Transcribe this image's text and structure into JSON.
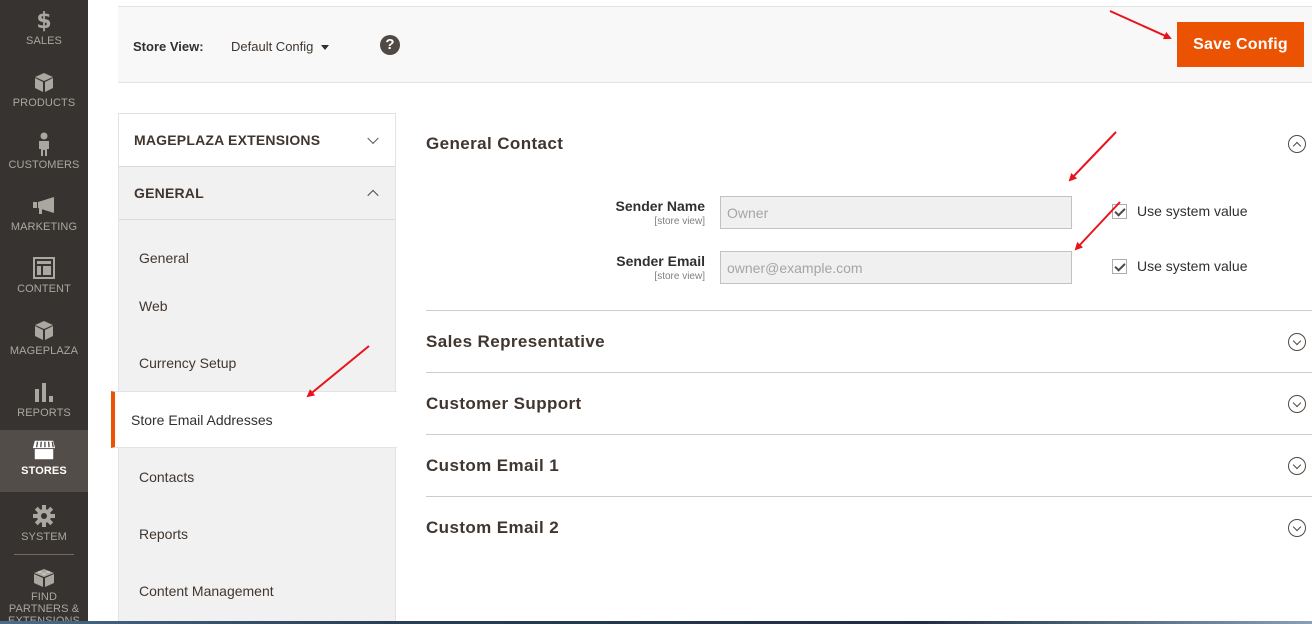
{
  "admin_nav": {
    "items": [
      {
        "label": "SALES",
        "icon": "dollar-icon"
      },
      {
        "label": "PRODUCTS",
        "icon": "box-icon"
      },
      {
        "label": "CUSTOMERS",
        "icon": "person-icon"
      },
      {
        "label": "MARKETING",
        "icon": "megaphone-icon"
      },
      {
        "label": "CONTENT",
        "icon": "layout-icon"
      },
      {
        "label": "MAGEPLAZA",
        "icon": "box-icon"
      },
      {
        "label": "REPORTS",
        "icon": "bar-chart-icon"
      },
      {
        "label": "STORES",
        "icon": "storefront-icon",
        "active": true
      },
      {
        "label": "SYSTEM",
        "icon": "gear-icon"
      },
      {
        "label": "FIND PARTNERS & EXTENSIONS",
        "icon": "lego-brick-icon"
      }
    ]
  },
  "page_actions": {
    "store_view_label": "Store View:",
    "store_view_value": "Default Config",
    "help_label": "?",
    "save_label": "Save Config"
  },
  "config_tabs": {
    "groups": [
      {
        "label": "MAGEPLAZA EXTENSIONS",
        "expanded": false
      },
      {
        "label": "GENERAL",
        "expanded": true
      }
    ],
    "items": [
      {
        "label": "General"
      },
      {
        "label": "Web"
      },
      {
        "label": "Currency Setup"
      },
      {
        "label": "Store Email Addresses",
        "active": true
      },
      {
        "label": "Contacts"
      },
      {
        "label": "Reports"
      },
      {
        "label": "Content Management"
      }
    ]
  },
  "main": {
    "sections": [
      {
        "title": "General Contact",
        "expanded": true
      },
      {
        "title": "Sales Representative",
        "expanded": false
      },
      {
        "title": "Customer Support",
        "expanded": false
      },
      {
        "title": "Custom Email 1",
        "expanded": false
      },
      {
        "title": "Custom Email 2",
        "expanded": false
      }
    ],
    "fields": [
      {
        "label": "Sender Name",
        "scope": "[store view]",
        "value": "Owner",
        "use_system_value": true,
        "checkbox_label": "Use system value"
      },
      {
        "label": "Sender Email",
        "scope": "[store view]",
        "value": "owner@example.com",
        "use_system_value": true,
        "checkbox_label": "Use system value"
      }
    ]
  },
  "colors": {
    "accent": "#eb5202",
    "nav_bg": "#373330",
    "nav_active_bg": "#524d49",
    "annotation_arrow": "#e8141b"
  }
}
